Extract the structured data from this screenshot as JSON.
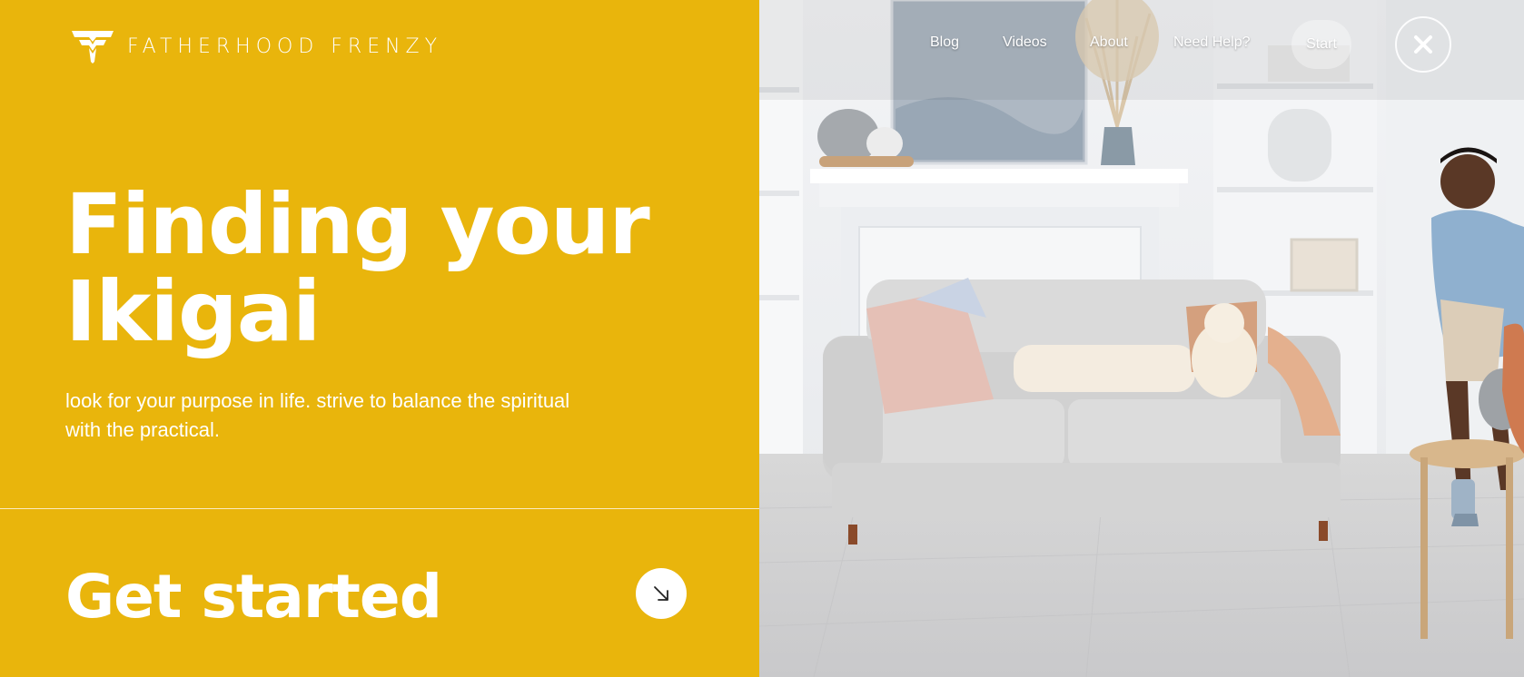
{
  "brand": {
    "name": "FATHERHOOD FRENZY"
  },
  "nav": {
    "items": [
      "Blog",
      "Videos",
      "About",
      "Need Help?"
    ],
    "start_label": "Start"
  },
  "hero": {
    "title": "Finding your Ikigai",
    "subtitle": "look for your purpose in life. strive to balance the spiritual with the practical."
  },
  "cta": {
    "label": "Get started"
  },
  "colors": {
    "accent": "#E9B50C",
    "text_on_accent": "#FFFFFF"
  },
  "icons": {
    "logo": "logo-mark-icon",
    "close": "close-icon",
    "cta_arrow": "arrow-down-right-icon"
  }
}
